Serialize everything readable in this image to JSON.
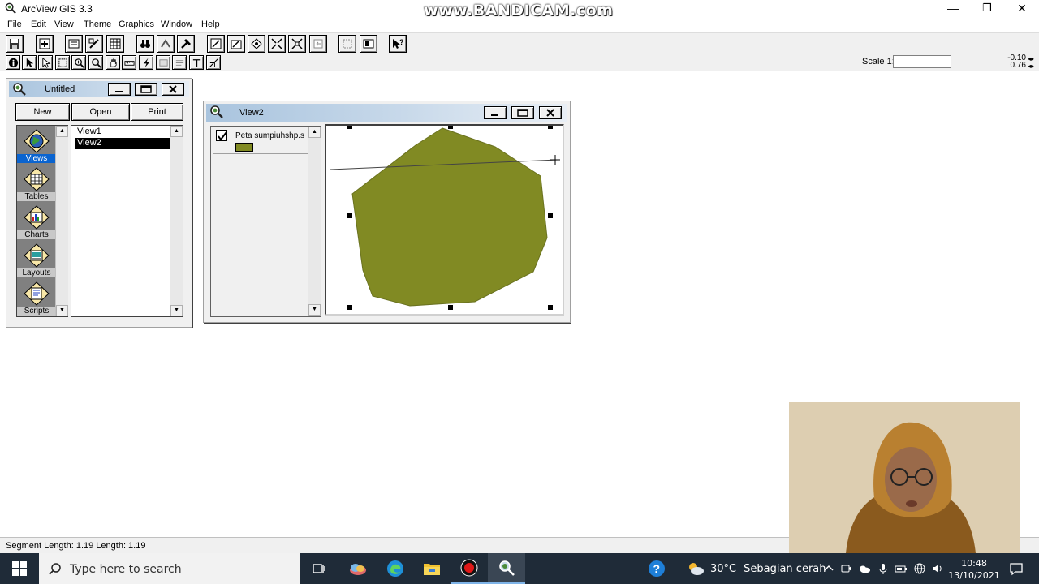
{
  "app": {
    "title": "ArcView GIS 3.3",
    "watermark": "www.BANDICAM.com",
    "window_controls": {
      "minimize": "—",
      "restore": "❐",
      "close": "✕"
    }
  },
  "menu": [
    "File",
    "Edit",
    "View",
    "Theme",
    "Graphics",
    "Window",
    "Help"
  ],
  "scale": {
    "label": "Scale 1:",
    "value": ""
  },
  "coords": {
    "x": "-0.10",
    "y": "0.76"
  },
  "project_window": {
    "title": "Untitled",
    "buttons": {
      "new": "New",
      "open": "Open",
      "print": "Print"
    },
    "doc_types": [
      {
        "label": "Views",
        "icon": "globe-icon",
        "active": true
      },
      {
        "label": "Tables",
        "icon": "table-icon",
        "active": false
      },
      {
        "label": "Charts",
        "icon": "chart-icon",
        "active": false
      },
      {
        "label": "Layouts",
        "icon": "layout-icon",
        "active": false
      },
      {
        "label": "Scripts",
        "icon": "script-icon",
        "active": false
      }
    ],
    "documents": [
      {
        "label": "View1",
        "selected": false
      },
      {
        "label": "View2",
        "selected": true
      }
    ]
  },
  "view_window": {
    "title": "View2",
    "theme": {
      "name": "Peta sumpiuhshp.s",
      "visible": true,
      "color": "#818a23"
    }
  },
  "status": {
    "text": "Segment Length: 1.19   Length: 1.19"
  },
  "taskbar": {
    "search_placeholder": "Type here to search",
    "weather_temp": "30°C",
    "weather_desc": "Sebagian cerah",
    "time": "10:48",
    "date": "13/10/2021"
  },
  "colors": {
    "polygon": "#818a23",
    "taskbar": "#1f2b38",
    "selection": "#000000"
  }
}
